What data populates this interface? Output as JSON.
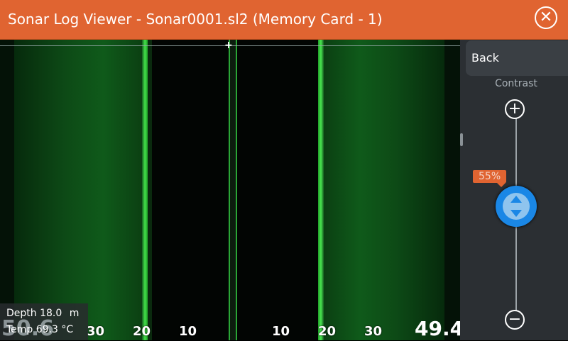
{
  "window": {
    "title": "Sonar Log Viewer - Sonar0001.sl2 (Memory Card - 1)",
    "close_icon": "close-icon"
  },
  "sonar": {
    "range_labels": [
      "30",
      "20",
      "10",
      "10",
      "20",
      "30"
    ],
    "bottom_right_value": "49.4"
  },
  "readout": {
    "big_value": "50.6",
    "depth_label": "Depth",
    "depth_value": "18.0",
    "depth_unit": "m",
    "temp_label": "Temp",
    "temp_value": "69.3",
    "temp_unit": "°C"
  },
  "sidebar": {
    "back_label": "Back",
    "contrast_label": "Contrast",
    "contrast_percent": "55%",
    "contrast_level": 0.55
  },
  "colors": {
    "accent": "#e06431",
    "knob": "#1a87e6",
    "sonar_green": "#39ff3a"
  }
}
